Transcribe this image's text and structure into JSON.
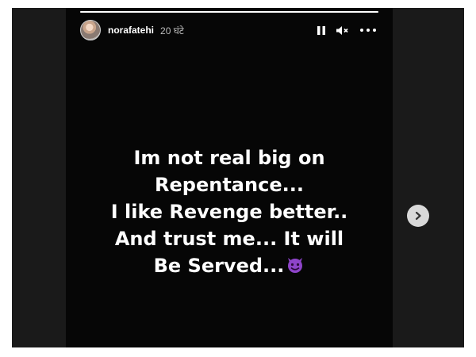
{
  "story": {
    "username": "norafatehi",
    "timestamp": "20 घंटे",
    "progress": 1.0,
    "lines": [
      "Im not real big on",
      "Repentance...",
      "I like Revenge better..",
      "And trust me... It will",
      "Be Served..."
    ],
    "emoji": "smiling-devil-emoji"
  },
  "controls": {
    "pause_icon": "pause-icon",
    "mute_icon": "muted-speaker-icon",
    "more_icon": "more-options-icon",
    "next_icon": "chevron-right-icon"
  },
  "colors": {
    "background": "#1a1a1a",
    "story_background": "#060606",
    "text": "#ffffff",
    "next_button": "#d9d9d9"
  }
}
